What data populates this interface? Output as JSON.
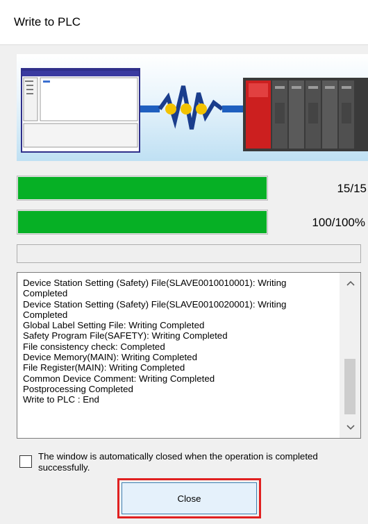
{
  "window": {
    "title": "Write to PLC"
  },
  "progress": {
    "overall": {
      "text": "15/15",
      "fraction": 1.0
    },
    "current": {
      "text": "100/100%",
      "fraction": 1.0
    },
    "status_text": ""
  },
  "log": {
    "lines": [
      "Device Station Setting (Safety) File(SLAVE0010010001): Writing",
      "Completed",
      "Device Station Setting (Safety) File(SLAVE0010020001): Writing",
      "Completed",
      "Global Label Setting File: Writing Completed",
      "Safety Program File(SAFETY): Writing Completed",
      "File consistency check: Completed",
      "Device Memory(MAIN): Writing Completed",
      "File Register(MAIN): Writing Completed",
      "Common Device Comment: Writing Completed",
      "Postprocessing Completed",
      "Write to PLC : End"
    ],
    "scroll_up_icon": "chevron-up-icon",
    "scroll_down_icon": "chevron-down-icon"
  },
  "options": {
    "auto_close_label": "The window is automatically closed when the operation is completed successfully.",
    "auto_close_checked": false
  },
  "buttons": {
    "close_label": "Close"
  },
  "colors": {
    "progress_green": "#06b025",
    "highlight_red": "#e02020",
    "button_bg": "#e5f1fb"
  }
}
